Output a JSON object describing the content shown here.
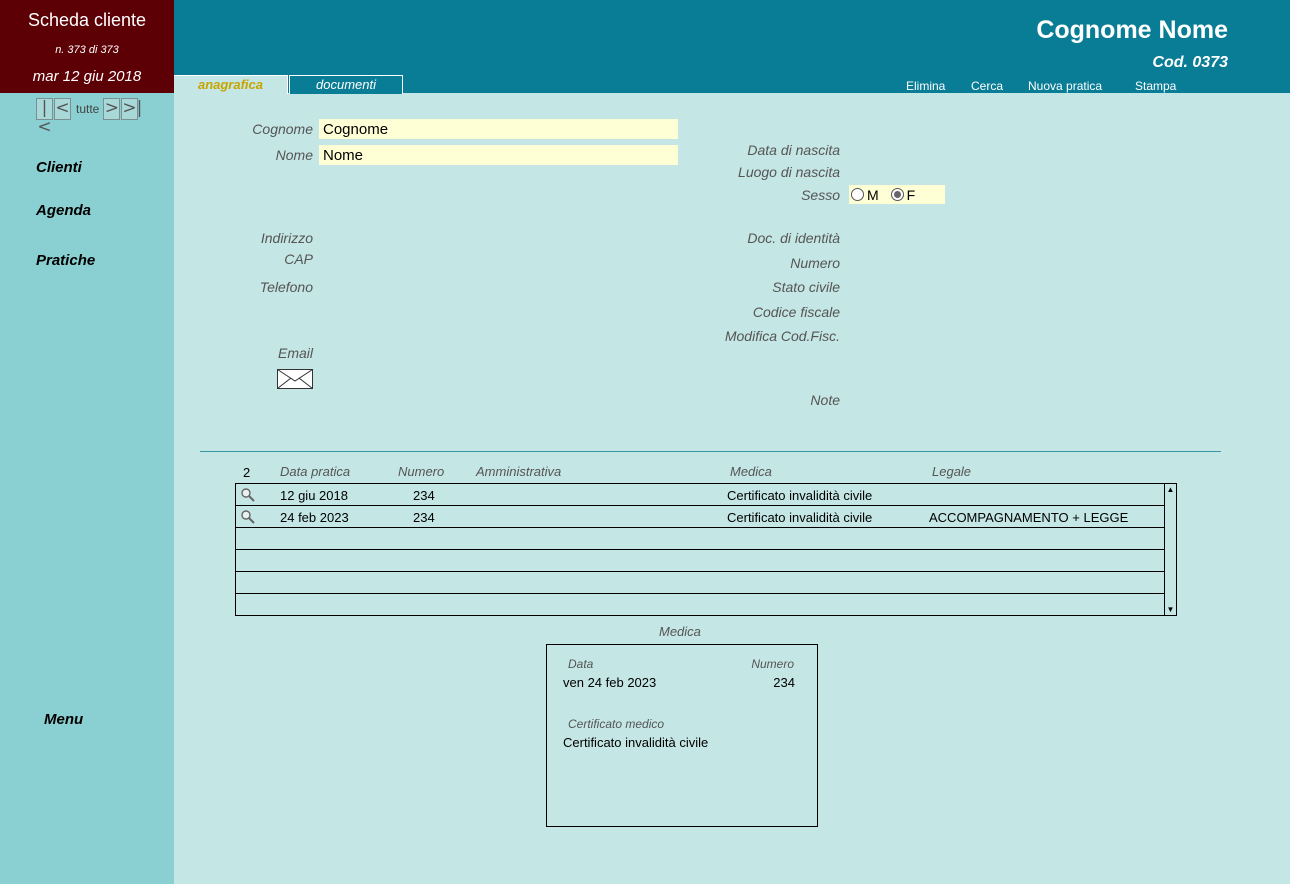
{
  "window": {
    "title": "Scheda cliente",
    "record_position": "n. 373 di 373",
    "date": "mar 12 giu 2018"
  },
  "record_nav": {
    "first": "|<",
    "prev": "<",
    "all": "tutte",
    "next": ">",
    "last": ">|"
  },
  "sidebar": {
    "clienti": "Clienti",
    "agenda": "Agenda",
    "pratiche": "Pratiche",
    "menu": "Menu"
  },
  "header": {
    "client_name": "Cognome Nome",
    "client_code": "Cod. 0373",
    "tabs": {
      "anagrafica": "anagrafica",
      "documenti": "documenti"
    },
    "actions": {
      "elimina": "Elimina",
      "cerca": "Cerca",
      "nuova_pratica": "Nuova pratica",
      "stampa": "Stampa"
    }
  },
  "form": {
    "cognome_label": "Cognome",
    "cognome_value": "Cognome",
    "nome_label": "Nome",
    "nome_value": "Nome",
    "indirizzo_label": "Indirizzo",
    "cap_label": "CAP",
    "telefono_label": "Telefono",
    "email_label": "Email",
    "data_nascita_label": "Data di nascita",
    "luogo_nascita_label": "Luogo di nascita",
    "sesso_label": "Sesso",
    "sesso_m": "M",
    "sesso_f": "F",
    "sesso_selected": "F",
    "doc_identita_label": "Doc. di identità",
    "numero_label": "Numero",
    "stato_civile_label": "Stato civile",
    "codice_fiscale_label": "Codice fiscale",
    "modifica_cf_label": "Modifica Cod.Fisc.",
    "note_label": "Note"
  },
  "practices": {
    "count": "2",
    "headers": {
      "data": "Data pratica",
      "numero": "Numero",
      "amministrativa": "Amministrativa",
      "medica": "Medica",
      "legale": "Legale"
    },
    "rows": [
      {
        "data": "12 giu 2018",
        "numero": "234",
        "amministrativa": "",
        "medica": "Certificato invalidità civile",
        "legale": ""
      },
      {
        "data": "24 feb 2023",
        "numero": "234",
        "amministrativa": "",
        "medica": "Certificato invalidità civile",
        "legale": "ACCOMPAGNAMENTO + LEGGE"
      }
    ]
  },
  "detail": {
    "title": "Medica",
    "data_label": "Data",
    "numero_label": "Numero",
    "data_value": "ven 24 feb 2023",
    "numero_value": "234",
    "certificato_label": "Certificato medico",
    "certificato_value": "Certificato invalidità civile"
  }
}
